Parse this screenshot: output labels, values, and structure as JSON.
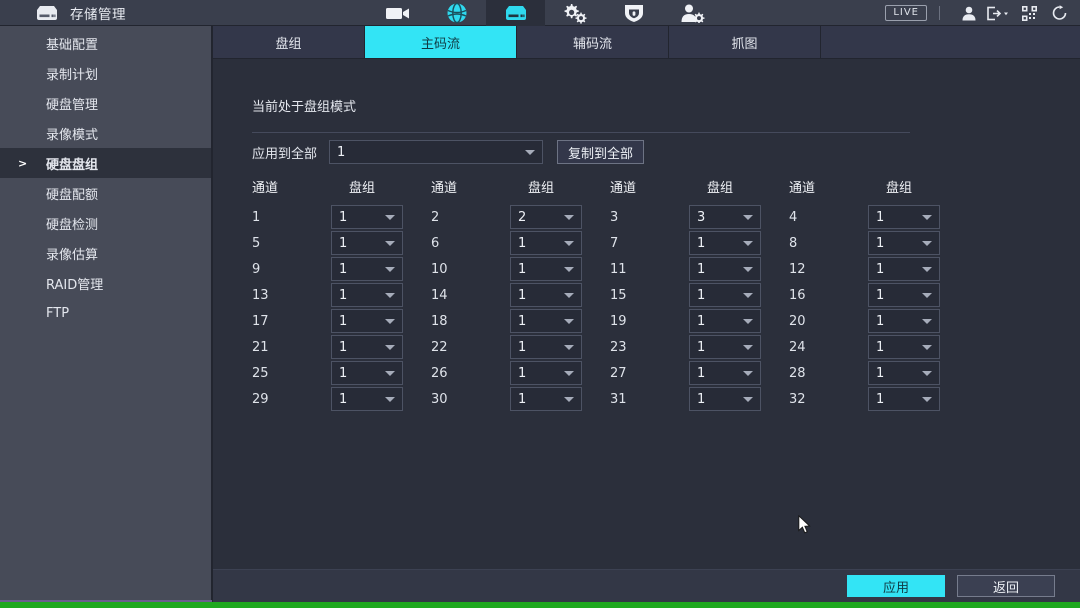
{
  "titlebar": {
    "app_title": "存储管理",
    "title_icon": "storage-hdd-icon",
    "nav_icons": [
      {
        "name": "camera-icon",
        "active": false
      },
      {
        "name": "network-globe-icon",
        "active": false
      },
      {
        "name": "storage-hdd-icon",
        "active": true
      },
      {
        "name": "settings-gears-icon",
        "active": false
      },
      {
        "name": "shield-icon",
        "active": false
      },
      {
        "name": "user-settings-icon",
        "active": false
      }
    ],
    "live_badge": "LIVE",
    "right_icons": [
      {
        "name": "user-icon"
      },
      {
        "name": "logout-icon"
      },
      {
        "name": "qrcode-icon"
      },
      {
        "name": "refresh-icon"
      }
    ]
  },
  "sidebar": {
    "items": [
      {
        "label": "基础配置",
        "active": false
      },
      {
        "label": "录制计划",
        "active": false
      },
      {
        "label": "硬盘管理",
        "active": false
      },
      {
        "label": "录像模式",
        "active": false
      },
      {
        "label": "硬盘盘组",
        "active": true,
        "marker": ">"
      },
      {
        "label": "硬盘配额",
        "active": false
      },
      {
        "label": "硬盘检测",
        "active": false
      },
      {
        "label": "录像估算",
        "active": false
      },
      {
        "label": "RAID管理",
        "active": false
      },
      {
        "label": "FTP",
        "active": false
      }
    ]
  },
  "tabs": [
    {
      "label": "盘组",
      "active": false
    },
    {
      "label": "主码流",
      "active": true
    },
    {
      "label": "辅码流",
      "active": false
    },
    {
      "label": "抓图",
      "active": false
    }
  ],
  "panel": {
    "mode_text": "当前处于盘组模式",
    "apply_label": "应用到全部",
    "apply_value": "1",
    "copy_button": "复制到全部",
    "header_channel": "通道",
    "header_diskgroup": "盘组",
    "rows": [
      [
        {
          "ch": "1",
          "dg": "1"
        },
        {
          "ch": "2",
          "dg": "2"
        },
        {
          "ch": "3",
          "dg": "3"
        },
        {
          "ch": "4",
          "dg": "1"
        }
      ],
      [
        {
          "ch": "5",
          "dg": "1"
        },
        {
          "ch": "6",
          "dg": "1"
        },
        {
          "ch": "7",
          "dg": "1"
        },
        {
          "ch": "8",
          "dg": "1"
        }
      ],
      [
        {
          "ch": "9",
          "dg": "1"
        },
        {
          "ch": "10",
          "dg": "1"
        },
        {
          "ch": "11",
          "dg": "1"
        },
        {
          "ch": "12",
          "dg": "1"
        }
      ],
      [
        {
          "ch": "13",
          "dg": "1"
        },
        {
          "ch": "14",
          "dg": "1"
        },
        {
          "ch": "15",
          "dg": "1"
        },
        {
          "ch": "16",
          "dg": "1"
        }
      ],
      [
        {
          "ch": "17",
          "dg": "1"
        },
        {
          "ch": "18",
          "dg": "1"
        },
        {
          "ch": "19",
          "dg": "1"
        },
        {
          "ch": "20",
          "dg": "1"
        }
      ],
      [
        {
          "ch": "21",
          "dg": "1"
        },
        {
          "ch": "22",
          "dg": "1"
        },
        {
          "ch": "23",
          "dg": "1"
        },
        {
          "ch": "24",
          "dg": "1"
        }
      ],
      [
        {
          "ch": "25",
          "dg": "1"
        },
        {
          "ch": "26",
          "dg": "1"
        },
        {
          "ch": "27",
          "dg": "1"
        },
        {
          "ch": "28",
          "dg": "1"
        }
      ],
      [
        {
          "ch": "29",
          "dg": "1"
        },
        {
          "ch": "30",
          "dg": "1"
        },
        {
          "ch": "31",
          "dg": "1"
        },
        {
          "ch": "32",
          "dg": "1"
        }
      ]
    ]
  },
  "footer": {
    "apply_button": "应用",
    "back_button": "返回"
  },
  "colors": {
    "accent_cyan": "#33e4f5",
    "sidebar_bg": "#474b58",
    "content_bg": "#2b2f3b",
    "titlebar_bg": "#3a3f4d",
    "status_green": "#1fa81f"
  }
}
